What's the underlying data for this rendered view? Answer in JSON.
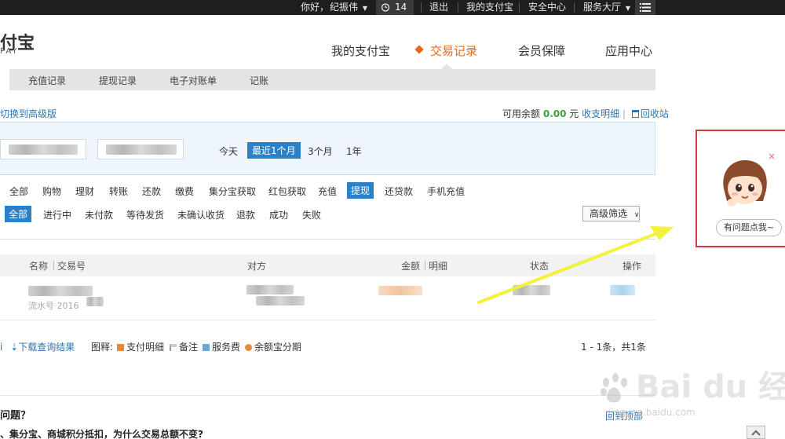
{
  "topbar": {
    "greeting": "你好，",
    "username": "纪振伟",
    "alarm_count": "14",
    "logout": "退出",
    "my_alipay": "我的支付宝",
    "security": "安全中心",
    "service": "服务大厅"
  },
  "logo": {
    "text": "付宝",
    "sub": "PAY"
  },
  "nav": {
    "items": [
      {
        "label": "我的支付宝"
      },
      {
        "label": "交易记录"
      },
      {
        "label": "会员保障"
      },
      {
        "label": "应用中心"
      }
    ]
  },
  "subnav": {
    "items": [
      "充值记录",
      "提现记录",
      "电子对账单",
      "记账"
    ]
  },
  "switch_link": "切换到高级版",
  "balance": {
    "label": "可用余额",
    "amount": "0.00",
    "unit": "元",
    "detail_link": "收支明细",
    "recycle_link": "回收站"
  },
  "date_filter": {
    "options": [
      "今天",
      "最近1个月",
      "3个月",
      "1年"
    ],
    "selected": "最近1个月"
  },
  "type_filter": {
    "items": [
      "全部",
      "购物",
      "理财",
      "转账",
      "还款",
      "缴费",
      "集分宝获取",
      "红包获取",
      "充值",
      "提现",
      "还贷款",
      "手机充值"
    ],
    "selected": "提现"
  },
  "status_filter": {
    "items": [
      "全部",
      "进行中",
      "未付款",
      "等待发货",
      "未确认收货",
      "退款",
      "成功",
      "失败"
    ],
    "selected": "全部",
    "advanced": "高级筛选"
  },
  "table": {
    "headers": [
      "名称",
      "交易号",
      "对方",
      "金额",
      "明细",
      "状态",
      "操作"
    ],
    "row_partial_text": "流水号 2016"
  },
  "legend": {
    "download": "下载查询结果",
    "label": "图释:",
    "items": [
      "支付明细",
      "备注",
      "服务费",
      "余额宝分期"
    ],
    "pagination": "1 - 1条，共1条"
  },
  "faq": {
    "title": "问题？",
    "item": "、集分宝、商城积分抵扣，为什么交易总额不变?",
    "back_top": "回到顶部"
  },
  "help_widget": {
    "bubble": "有问题点我~",
    "close": "×"
  },
  "watermark": {
    "text": "Bai du 经验",
    "sub": "jingyan.baidu.com"
  },
  "colors": {
    "accent_orange": "#e46a1a",
    "link_blue": "#2d74b5",
    "selected_blue": "#2b81c8",
    "balance_green": "#3aa436",
    "highlight_red": "#d9393b",
    "arrow_yellow": "#f5f542"
  }
}
